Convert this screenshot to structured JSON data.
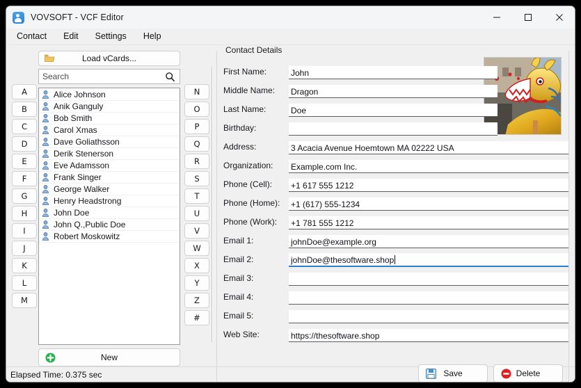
{
  "window": {
    "title": "VOVSOFT - VCF Editor",
    "app_icon": "contact-card-icon",
    "controls": {
      "minimize": "minimize-icon",
      "maximize": "maximize-icon",
      "close": "close-icon"
    }
  },
  "menubar": {
    "items": [
      "Contact",
      "Edit",
      "Settings",
      "Help"
    ]
  },
  "sidebar": {
    "load_button": {
      "label": "Load vCards...",
      "icon": "folder-icon"
    },
    "search": {
      "value": "",
      "placeholder": "Search",
      "icon": "search-icon"
    },
    "new_button": {
      "label": "New",
      "icon": "plus-circle-icon"
    },
    "alpha_left": [
      "A",
      "B",
      "C",
      "D",
      "E",
      "F",
      "G",
      "H",
      "I",
      "J",
      "K",
      "L",
      "M"
    ],
    "alpha_right": [
      "N",
      "O",
      "P",
      "Q",
      "R",
      "S",
      "T",
      "U",
      "V",
      "W",
      "X",
      "Y",
      "Z",
      "#"
    ],
    "contacts": [
      "Alice Johnson",
      "Anik Ganguly",
      "Bob Smith",
      "Carol Xmas",
      "Dave Goliathsson",
      "Derik Stenerson",
      "Eve Adamsson",
      "Frank Singer",
      "George Walker",
      "Henry Headstrong",
      "John Doe",
      "John Q.,Public Doe",
      "Robert Moskowitz"
    ]
  },
  "details": {
    "group_title": "Contact Details",
    "photo_alt": "contact-photo-chinese-dragon",
    "fields": [
      {
        "label": "First Name:",
        "value": "John",
        "focused": false
      },
      {
        "label": "Middle Name:",
        "value": "Dragon",
        "focused": false
      },
      {
        "label": "Last Name:",
        "value": "Doe",
        "focused": false
      },
      {
        "label": "Birthday:",
        "value": "",
        "focused": false
      },
      {
        "label": "Address:",
        "value": "3 Acacia Avenue Hoemtown MA 02222 USA",
        "focused": false
      },
      {
        "label": "Organization:",
        "value": "Example.com Inc.",
        "focused": false
      },
      {
        "label": "Phone (Cell):",
        "value": "+1 617 555 1212",
        "focused": false
      },
      {
        "label": "Phone (Home):",
        "value": "+1 (617) 555-1234",
        "focused": false
      },
      {
        "label": "Phone (Work):",
        "value": "+1 781 555 1212",
        "focused": false
      },
      {
        "label": "Email 1:",
        "value": "johnDoe@example.org",
        "focused": false
      },
      {
        "label": "Email 2:",
        "value": "johnDoe@thesoftware.shop",
        "focused": true
      },
      {
        "label": "Email 3:",
        "value": "",
        "focused": false
      },
      {
        "label": "Email 4:",
        "value": "",
        "focused": false
      },
      {
        "label": "Email 5:",
        "value": "",
        "focused": false
      },
      {
        "label": "Web Site:",
        "value": "https://thesoftware.shop",
        "focused": false
      }
    ],
    "save_button": {
      "label": "Save",
      "icon": "floppy-disk-icon"
    },
    "delete_button": {
      "label": "Delete",
      "icon": "minus-circle-icon"
    }
  },
  "statusbar": {
    "text": "Elapsed Time: 0.375 sec"
  },
  "colors": {
    "accent": "#2a7fd4",
    "window_bg": "#f0f0f0",
    "field_bg": "#ffffff",
    "delete_red": "#e02020",
    "new_green": "#25b14c"
  }
}
